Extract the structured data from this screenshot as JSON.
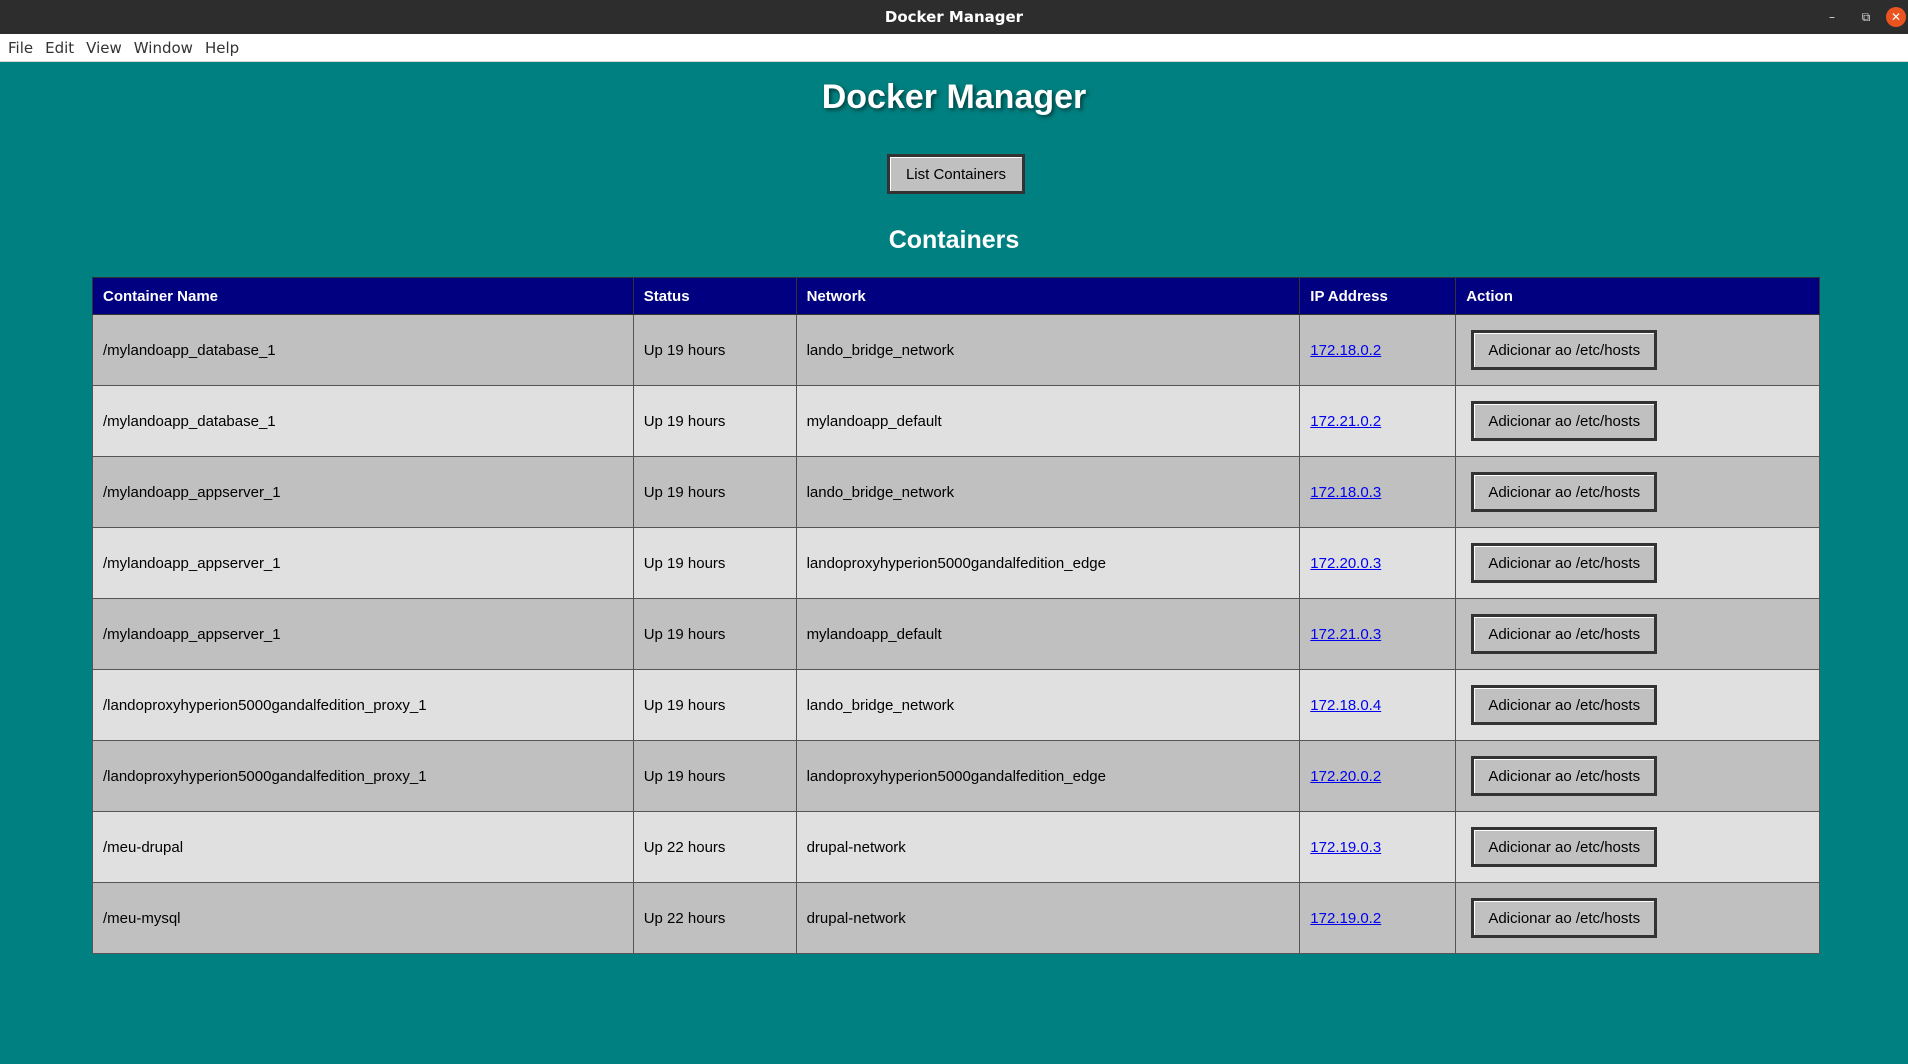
{
  "window": {
    "title": "Docker Manager",
    "controls": {
      "minimize": "–",
      "restore": "⧉",
      "close": "✕"
    }
  },
  "menu": {
    "items": [
      "File",
      "Edit",
      "View",
      "Window",
      "Help"
    ]
  },
  "header": {
    "title": "Docker Manager",
    "list_button_label": "List Containers"
  },
  "containers_section": {
    "title": "Containers",
    "columns": [
      "Container Name",
      "Status",
      "Network",
      "IP Address",
      "Action"
    ],
    "rows": [
      {
        "name": "/mylandoapp_database_1",
        "status": "Up 19 hours",
        "network": "lando_bridge_network",
        "ip": "172.18.0.2",
        "action": "Adicionar ao /etc/hosts"
      },
      {
        "name": "/mylandoapp_database_1",
        "status": "Up 19 hours",
        "network": "mylandoapp_default",
        "ip": "172.21.0.2",
        "action": "Adicionar ao /etc/hosts"
      },
      {
        "name": "/mylandoapp_appserver_1",
        "status": "Up 19 hours",
        "network": "lando_bridge_network",
        "ip": "172.18.0.3",
        "action": "Adicionar ao /etc/hosts"
      },
      {
        "name": "/mylandoapp_appserver_1",
        "status": "Up 19 hours",
        "network": "landoproxyhyperion5000gandalfedition_edge",
        "ip": "172.20.0.3",
        "action": "Adicionar ao /etc/hosts"
      },
      {
        "name": "/mylandoapp_appserver_1",
        "status": "Up 19 hours",
        "network": "mylandoapp_default",
        "ip": "172.21.0.3",
        "action": "Adicionar ao /etc/hosts"
      },
      {
        "name": "/landoproxyhyperion5000gandalfedition_proxy_1",
        "status": "Up 19 hours",
        "network": "lando_bridge_network",
        "ip": "172.18.0.4",
        "action": "Adicionar ao /etc/hosts"
      },
      {
        "name": "/landoproxyhyperion5000gandalfedition_proxy_1",
        "status": "Up 19 hours",
        "network": "landoproxyhyperion5000gandalfedition_edge",
        "ip": "172.20.0.2",
        "action": "Adicionar ao /etc/hosts"
      },
      {
        "name": "/meu-drupal",
        "status": "Up 22 hours",
        "network": "drupal-network",
        "ip": "172.19.0.3",
        "action": "Adicionar ao /etc/hosts"
      },
      {
        "name": "/meu-mysql",
        "status": "Up 22 hours",
        "network": "drupal-network",
        "ip": "172.19.0.2",
        "action": "Adicionar ao /etc/hosts"
      }
    ]
  },
  "colors": {
    "background": "#008080",
    "table_header": "#000080",
    "row_odd": "#c0c0c0",
    "row_even": "#e0e0e0",
    "link": "#0000ee",
    "close_button": "#e95420"
  }
}
